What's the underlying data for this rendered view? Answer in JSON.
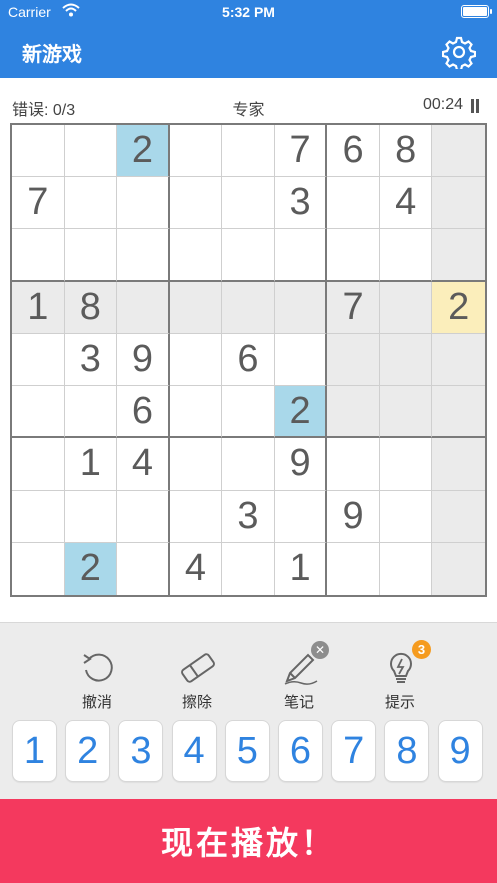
{
  "status_bar": {
    "carrier": "Carrier",
    "time": "5:32 PM"
  },
  "nav": {
    "title": "新游戏"
  },
  "game_info": {
    "mistakes": "错误: 0/3",
    "difficulty": "专家",
    "timer": "00:24"
  },
  "board": {
    "rows": [
      [
        "",
        "",
        "2",
        "",
        "",
        "7",
        "6",
        "8",
        ""
      ],
      [
        "7",
        "",
        "",
        "",
        "",
        "3",
        "",
        "4",
        ""
      ],
      [
        "",
        "",
        "",
        "",
        "",
        "",
        "",
        "",
        ""
      ],
      [
        "1",
        "8",
        "",
        "",
        "",
        "",
        "7",
        "",
        "2"
      ],
      [
        "",
        "3",
        "9",
        "",
        "6",
        "",
        "",
        "",
        ""
      ],
      [
        "",
        "",
        "6",
        "",
        "",
        "2",
        "",
        "",
        ""
      ],
      [
        "",
        "1",
        "4",
        "",
        "",
        "9",
        "",
        "",
        ""
      ],
      [
        "",
        "",
        "",
        "",
        "3",
        "",
        "9",
        "",
        ""
      ],
      [
        "",
        "2",
        "",
        "4",
        "",
        "1",
        "",
        "",
        ""
      ]
    ],
    "selected_cell": [
      3,
      8
    ],
    "highlight_value": "2"
  },
  "tools": [
    {
      "label": "撤消",
      "icon": "undo-icon"
    },
    {
      "label": "擦除",
      "icon": "eraser-icon"
    },
    {
      "label": "笔记",
      "icon": "pencil-icon",
      "badge_icon": "close-icon"
    },
    {
      "label": "提示",
      "icon": "lightbulb-icon",
      "badge": "3"
    }
  ],
  "numpad": [
    "1",
    "2",
    "3",
    "4",
    "5",
    "6",
    "7",
    "8",
    "9"
  ],
  "play_button": {
    "label": "现在播放！"
  },
  "colors": {
    "header_blue": "#2f83e0",
    "number_blue": "#2f83e0",
    "play_red": "#f4395e",
    "same_value_highlight": "#a9d8ea",
    "selected_cell": "#fbeebb",
    "peer_highlight": "#ebebeb",
    "hint_badge": "#f59b1f"
  }
}
